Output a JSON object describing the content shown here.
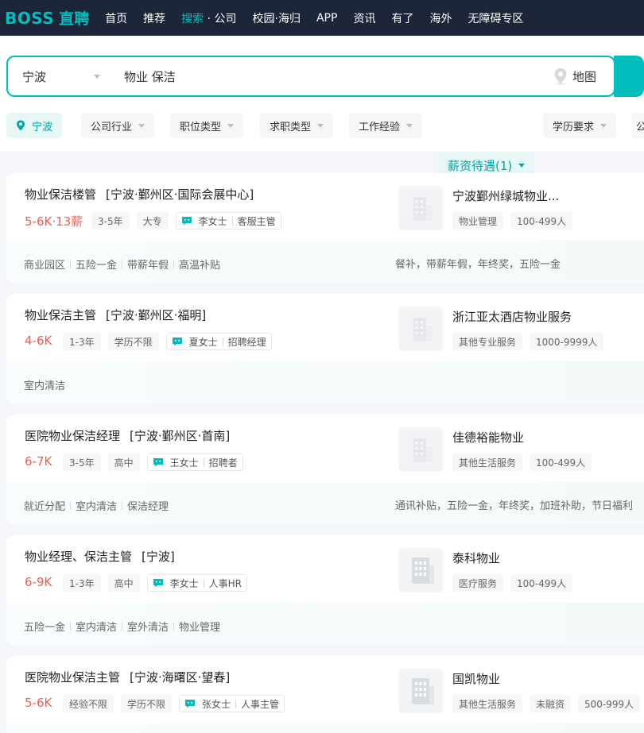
{
  "header": {
    "logo_en": "BOSS",
    "logo_cn": "直聘",
    "nav": [
      {
        "label": "首页"
      },
      {
        "label": "推荐"
      },
      {
        "label": "搜索",
        "suffix": "公司"
      },
      {
        "label": "校园·海归"
      },
      {
        "label": "APP"
      },
      {
        "label": "资讯"
      },
      {
        "label": "有了"
      },
      {
        "label": "海外"
      },
      {
        "label": "无障碍专区"
      }
    ]
  },
  "search": {
    "city": "宁波",
    "query": "物业 保洁",
    "map_label": "地图"
  },
  "filters": [
    {
      "label": "宁波"
    },
    {
      "label": "公司行业"
    },
    {
      "label": "职位类型"
    },
    {
      "label": "求职类型"
    },
    {
      "label": "工作经验"
    },
    {
      "label": "薪资待遇(1)"
    },
    {
      "label": "学历要求"
    },
    {
      "label": "公"
    }
  ],
  "jobs": [
    {
      "title": "物业保洁楼管",
      "location": "[宁波·鄞州区·国际会展中心]",
      "salary": "5-6K·13薪",
      "experience": "3-5年",
      "education": "大专",
      "recruiter_name": "李女士",
      "recruiter_title": "客服主管",
      "company": "宁波鄞州绿城物业...",
      "industry": "物业管理",
      "size": "100-499人",
      "funding": "",
      "skills": [
        "商业园区",
        "五险一金",
        "带薪年假",
        "高温补贴"
      ],
      "welfare": "餐补，带薪年假，年终奖，五险一金",
      "logo_icon": "building-icon"
    },
    {
      "title": "物业保洁主管",
      "location": "[宁波·鄞州区·福明]",
      "salary": "4-6K",
      "experience": "1-3年",
      "education": "学历不限",
      "recruiter_name": "夏女士",
      "recruiter_title": "招聘经理",
      "company": "浙江亚太酒店物业服务",
      "industry": "其他专业服务",
      "size": "1000-9999人",
      "funding": "",
      "skills": [
        "室内清洁"
      ],
      "welfare": "",
      "logo_icon": "building-icon"
    },
    {
      "title": "医院物业保洁经理",
      "location": "[宁波·鄞州区·首南]",
      "salary": "6-7K",
      "experience": "3-5年",
      "education": "高中",
      "recruiter_name": "王女士",
      "recruiter_title": "招聘者",
      "company": "佳德裕能物业",
      "industry": "其他生活服务",
      "size": "100-499人",
      "funding": "",
      "skills": [
        "就近分配",
        "室内清洁",
        "保洁经理"
      ],
      "welfare": "通讯补贴，五险一金，年终奖，加班补助，节日福利",
      "logo_icon": "building-icon"
    },
    {
      "title": "物业经理、保洁主管",
      "location": "[宁波]",
      "salary": "6-9K",
      "experience": "1-3年",
      "education": "高中",
      "recruiter_name": "李女士",
      "recruiter_title": "人事HR",
      "company": "泰科物业",
      "industry": "医疗服务",
      "size": "100-499人",
      "funding": "",
      "skills": [
        "五险一金",
        "室内清洁",
        "室外清洁",
        "物业管理"
      ],
      "welfare": "",
      "logo_icon": "office-building-icon"
    },
    {
      "title": "医院物业保洁主管",
      "location": "[宁波·海曙区·望春]",
      "salary": "5-6K",
      "experience": "经验不限",
      "education": "学历不限",
      "recruiter_name": "张女士",
      "recruiter_title": "人事主管",
      "company": "国凯物业",
      "industry": "其他生活服务",
      "size": "500-999人",
      "funding": "未融资",
      "skills": [],
      "welfare": "",
      "logo_icon": "office-building-icon"
    }
  ],
  "colors": {
    "accent": "#00bebd",
    "salary": "#fe574a",
    "header_bg": "#1c2638"
  }
}
